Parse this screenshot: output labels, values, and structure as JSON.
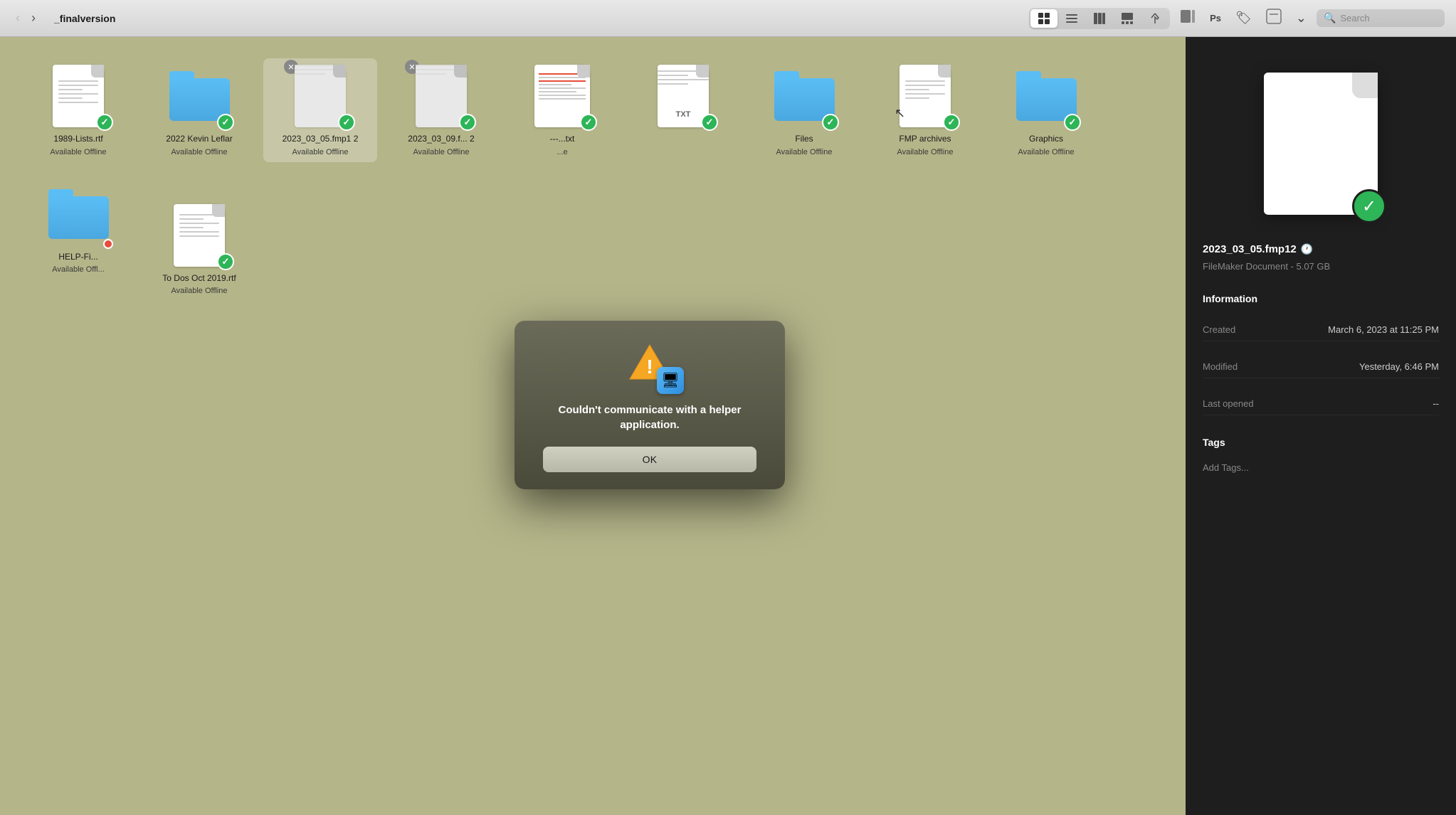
{
  "toolbar": {
    "back_label": "‹",
    "forward_label": "›",
    "title": "_finalversion",
    "search_placeholder": "Search",
    "view_buttons": [
      {
        "id": "icon",
        "label": "⊞",
        "active": true
      },
      {
        "id": "list",
        "label": "≡",
        "active": false
      },
      {
        "id": "column",
        "label": "⊟",
        "active": false
      },
      {
        "id": "gallery",
        "label": "⬜",
        "active": false
      },
      {
        "id": "pdf",
        "label": "△",
        "active": false
      }
    ],
    "action_buttons": [
      {
        "id": "preview",
        "label": "▣"
      },
      {
        "id": "ps",
        "label": "Ps"
      },
      {
        "id": "tag",
        "label": "🏷"
      },
      {
        "id": "more1",
        "label": "⬜"
      },
      {
        "id": "more2",
        "label": "⌄"
      }
    ]
  },
  "files": [
    {
      "id": "1989",
      "name": "1989-Lists.rtf",
      "subtitle": "Available Offline",
      "type": "rtf",
      "has_check": true,
      "has_x": false
    },
    {
      "id": "2022",
      "name": "2022 Kevin Leflar",
      "subtitle": "Available Offline",
      "type": "folder",
      "has_check": true,
      "has_x": false
    },
    {
      "id": "fmp1",
      "name": "2023_03_05.fmp12",
      "subtitle": "Available Offline",
      "type": "fmp",
      "has_check": true,
      "has_x": true,
      "selected": true
    },
    {
      "id": "2023b",
      "name": "2023_03_09.f... 2",
      "subtitle": "Available Offline",
      "type": "fmp2",
      "has_check": true,
      "has_x": true
    },
    {
      "id": "partdoc1",
      "name": "---...txt",
      "subtitle": "...e",
      "type": "partial_rtf",
      "has_check": true,
      "has_x": false
    },
    {
      "id": "txt1",
      "name": "",
      "subtitle": "",
      "type": "txt",
      "has_check": true,
      "has_x": false
    },
    {
      "id": "files",
      "name": "Files",
      "subtitle": "Available Offline",
      "type": "folder",
      "has_check": true,
      "has_x": false
    },
    {
      "id": "fmparch",
      "name": "FMP archives",
      "subtitle": "Available Offline",
      "type": "rtf2",
      "has_check": true,
      "has_x": false
    },
    {
      "id": "graphics",
      "name": "Graphics",
      "subtitle": "Available Offline",
      "type": "folder",
      "has_check": true,
      "has_x": false
    },
    {
      "id": "helpfi",
      "name": "HELP-FI...",
      "subtitle": "Available Offl...",
      "type": "folder_red",
      "has_check": false,
      "has_red": true
    },
    {
      "id": "todos",
      "name": "To Dos Oct 2019.rtf",
      "subtitle": "Available Offline",
      "type": "rtf3",
      "has_check": true,
      "has_x": false
    }
  ],
  "dialog": {
    "title": "Couldn't communicate with a helper application.",
    "ok_label": "OK"
  },
  "preview": {
    "filename": "2023_03_05.fmp12",
    "filetype": "FileMaker Document - 5.07 GB",
    "section_info": "Information",
    "created_label": "Created",
    "created_value": "March 6, 2023 at 11:25 PM",
    "modified_label": "Modified",
    "modified_value": "Yesterday, 6:46 PM",
    "last_opened_label": "Last opened",
    "last_opened_value": "--",
    "tags_label": "Tags",
    "tags_add": "Add Tags..."
  }
}
